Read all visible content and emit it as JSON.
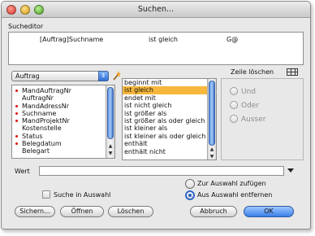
{
  "window": {
    "title": "Suchen..."
  },
  "editor": {
    "label": "Sucheditor",
    "criterion": {
      "field": "[Auftrag]Suchname",
      "operator": "ist gleich",
      "value": "G@"
    },
    "delete_row_label": "Zeile löschen"
  },
  "table_popup": {
    "selected": "Auftrag"
  },
  "fields": [
    {
      "label": "MandAuftragNr",
      "marked": true
    },
    {
      "label": "AuftragNr",
      "marked": false
    },
    {
      "label": "MandAdressNr",
      "marked": true
    },
    {
      "label": "Suchname",
      "marked": true
    },
    {
      "label": "MandProjektNr",
      "marked": true
    },
    {
      "label": "Kostenstelle",
      "marked": false
    },
    {
      "label": "Status",
      "marked": true
    },
    {
      "label": "Belegdatum",
      "marked": true
    },
    {
      "label": "Belegart",
      "marked": false
    }
  ],
  "operators": [
    {
      "label": "beginnt mit",
      "selected": false
    },
    {
      "label": "ist gleich",
      "selected": true
    },
    {
      "label": "endet mit",
      "selected": false
    },
    {
      "label": "ist nicht gleich",
      "selected": false
    },
    {
      "label": "ist größer als",
      "selected": false
    },
    {
      "label": "ist größer als oder gleich",
      "selected": false
    },
    {
      "label": "ist kleiner als",
      "selected": false
    },
    {
      "label": "ist kleiner als oder gleich",
      "selected": false
    },
    {
      "label": "enthält",
      "selected": false
    },
    {
      "label": "enthält nicht",
      "selected": false
    }
  ],
  "conjunction": {
    "und": "Und",
    "oder": "Oder",
    "ausser": "Ausser"
  },
  "wert": {
    "label": "Wert",
    "value": ""
  },
  "options": {
    "search_in_selection": "Suche in Auswahl",
    "add_to_selection": "Zur Auswahl zufügen",
    "remove_from_selection": "Aus Auswahl entfernen"
  },
  "buttons": {
    "save": "Sichern...",
    "open": "Öffnen",
    "delete": "Löschen",
    "cancel": "Abbruch",
    "ok": "OK"
  },
  "colors": {
    "selection": "#f6b73c",
    "accent": "#3a7ee6",
    "field_marker": "#dd1111"
  }
}
